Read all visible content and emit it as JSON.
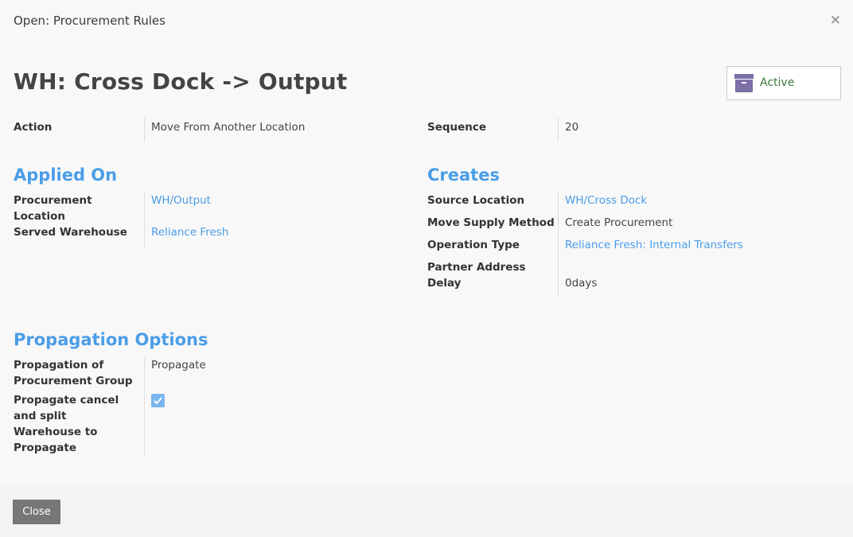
{
  "modal": {
    "title": "Open: Procurement Rules",
    "close_symbol": "×"
  },
  "record": {
    "title": "WH: Cross Dock -> Output",
    "status_label": "Active",
    "status_icon": "archive-icon"
  },
  "fields": {
    "action_label": "Action",
    "action_value": "Move From Another Location",
    "sequence_label": "Sequence",
    "sequence_value": "20"
  },
  "applied_on": {
    "title": "Applied On",
    "procurement_location_label_1": "Procurement",
    "procurement_location_label_2": "Location",
    "procurement_location_value": "WH/Output",
    "served_warehouse_label": "Served Warehouse",
    "served_warehouse_value": "Reliance Fresh"
  },
  "creates": {
    "title": "Creates",
    "source_location_label": "Source Location",
    "source_location_value": "WH/Cross Dock",
    "move_supply_label": "Move Supply Method",
    "move_supply_value": "Create Procurement",
    "operation_type_label": "Operation Type",
    "operation_type_value": "Reliance Fresh: Internal Transfers",
    "partner_delay_label_1": "Partner Address",
    "partner_delay_label_2": "Delay",
    "partner_delay_value": "0days"
  },
  "propagation": {
    "title": "Propagation Options",
    "group_label_1": "Propagation of",
    "group_label_2": "Procurement Group",
    "group_value": "Propagate",
    "cancel_label_1": "Propagate cancel",
    "cancel_label_2": "and split",
    "cancel_checked": true,
    "warehouse_label_1": "Warehouse to",
    "warehouse_label_2": "Propagate"
  },
  "footer": {
    "close_label": "Close"
  },
  "colors": {
    "link": "#4a9de8",
    "active_text": "#3c763d",
    "close_button": "#777777",
    "archive_icon": "#7b6fa6"
  }
}
